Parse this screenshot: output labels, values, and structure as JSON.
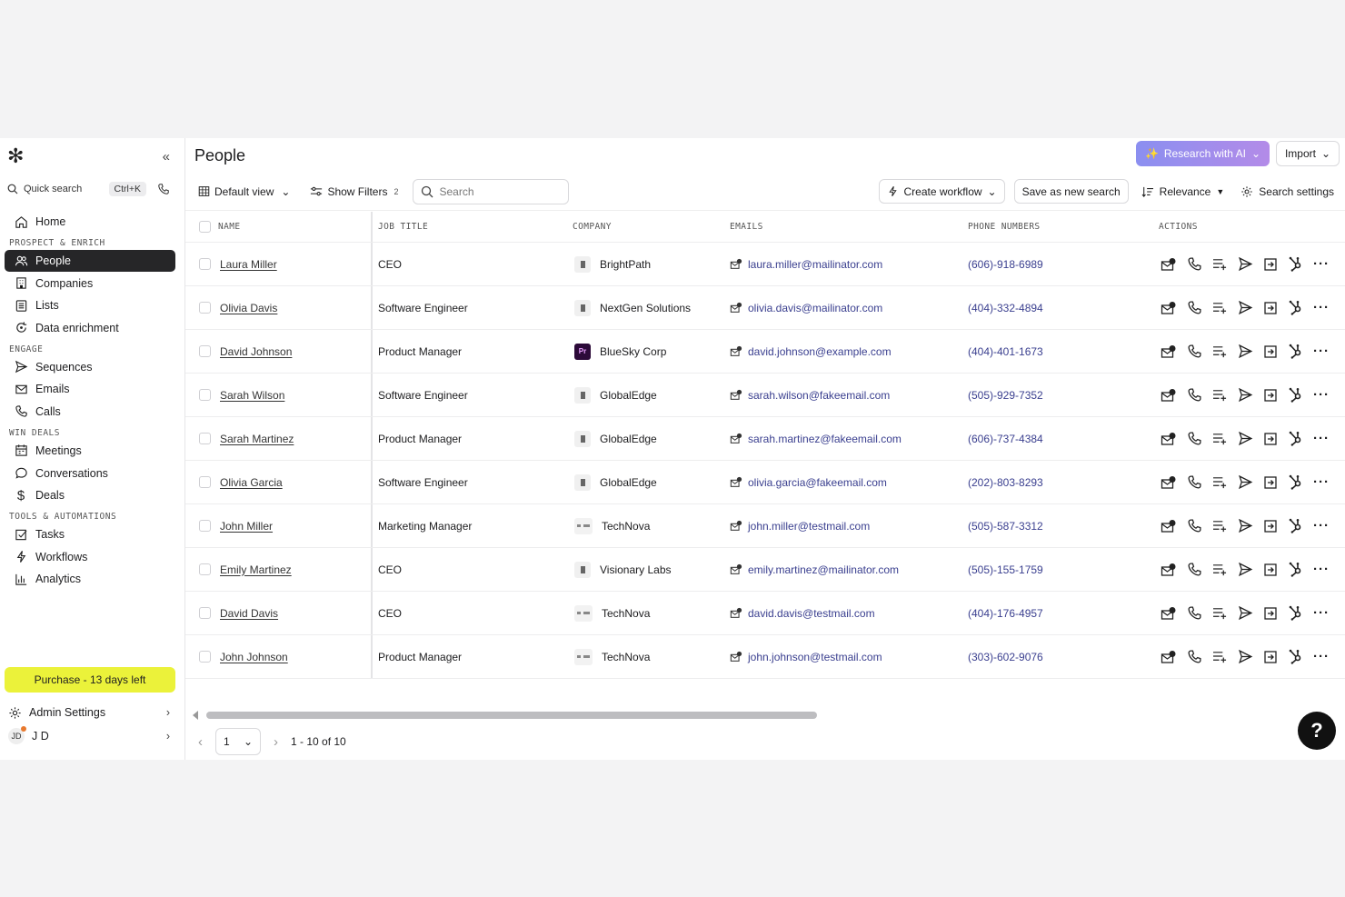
{
  "sidebar": {
    "quick_search": "Quick search",
    "shortcut": "Ctrl+K",
    "home": "Home",
    "sections": {
      "prospect": "PROSPECT & ENRICH",
      "engage": "ENGAGE",
      "win": "WIN DEALS",
      "tools": "TOOLS & AUTOMATIONS"
    },
    "items": {
      "people": "People",
      "companies": "Companies",
      "lists": "Lists",
      "data_enrichment": "Data enrichment",
      "sequences": "Sequences",
      "emails": "Emails",
      "calls": "Calls",
      "meetings": "Meetings",
      "conversations": "Conversations",
      "deals": "Deals",
      "tasks": "Tasks",
      "workflows": "Workflows",
      "analytics": "Analytics"
    },
    "purchase": "Purchase - 13 days left",
    "admin_settings": "Admin Settings",
    "user_initials": "JD",
    "user_name": "J D"
  },
  "header": {
    "title": "People",
    "research_ai": "Research with AI",
    "import": "Import"
  },
  "toolbar": {
    "default_view": "Default view",
    "show_filters": "Show Filters",
    "filter_count": "2",
    "search_placeholder": "Search",
    "create_workflow": "Create workflow",
    "save_search": "Save as new search",
    "relevance": "Relevance",
    "search_settings": "Search settings"
  },
  "table": {
    "columns": {
      "name": "NAME",
      "job": "JOB TITLE",
      "company": "COMPANY",
      "emails": "EMAILS",
      "phones": "PHONE NUMBERS",
      "actions": "ACTIONS"
    },
    "rows": [
      {
        "name": "Laura Miller",
        "job": "CEO",
        "company": "BrightPath",
        "logo": "grey",
        "email": "laura.miller@mailinator.com",
        "phone": "(606)-918-6989"
      },
      {
        "name": "Olivia Davis",
        "job": "Software Engineer",
        "company": "NextGen Solutions",
        "logo": "grey",
        "email": "olivia.davis@mailinator.com",
        "phone": "(404)-332-4894"
      },
      {
        "name": "David Johnson",
        "job": "Product Manager",
        "company": "BlueSky Corp",
        "logo": "pr",
        "email": "david.johnson@example.com",
        "phone": "(404)-401-1673"
      },
      {
        "name": "Sarah Wilson",
        "job": "Software Engineer",
        "company": "GlobalEdge",
        "logo": "grey",
        "email": "sarah.wilson@fakeemail.com",
        "phone": "(505)-929-7352"
      },
      {
        "name": "Sarah Martinez",
        "job": "Product Manager",
        "company": "GlobalEdge",
        "logo": "grey",
        "email": "sarah.martinez@fakeemail.com",
        "phone": "(606)-737-4384"
      },
      {
        "name": "Olivia Garcia",
        "job": "Software Engineer",
        "company": "GlobalEdge",
        "logo": "grey",
        "email": "olivia.garcia@fakeemail.com",
        "phone": "(202)-803-8293"
      },
      {
        "name": "John Miller",
        "job": "Marketing Manager",
        "company": "TechNova",
        "logo": "tech",
        "email": "john.miller@testmail.com",
        "phone": "(505)-587-3312"
      },
      {
        "name": "Emily Martinez",
        "job": "CEO",
        "company": "Visionary Labs",
        "logo": "grey",
        "email": "emily.martinez@mailinator.com",
        "phone": "(505)-155-1759"
      },
      {
        "name": "David Davis",
        "job": "CEO",
        "company": "TechNova",
        "logo": "tech",
        "email": "david.davis@testmail.com",
        "phone": "(404)-176-4957"
      },
      {
        "name": "John Johnson",
        "job": "Product Manager",
        "company": "TechNova",
        "logo": "tech",
        "email": "john.johnson@testmail.com",
        "phone": "(303)-602-9076"
      }
    ]
  },
  "pager": {
    "page": "1",
    "range": "1 - 10 of 10"
  },
  "help": "?"
}
